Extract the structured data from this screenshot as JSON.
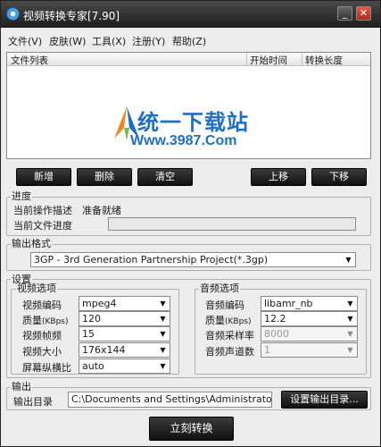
{
  "window": {
    "title": "视频转换专家[7.90]",
    "minimize_glyph": "_",
    "close_glyph": "✕"
  },
  "menu": [
    "文件(V)",
    "皮肤(W)",
    "工具(X)",
    "注册(Y)",
    "帮助(Z)"
  ],
  "file_list": {
    "columns": [
      "文件列表",
      "开始时间",
      "转换长度"
    ],
    "watermark_title": "统一下载站",
    "watermark_url": "Www.3987.Com"
  },
  "buttons": {
    "add": "新增",
    "delete": "删除",
    "clear": "清空",
    "up": "上移",
    "down": "下移"
  },
  "progress": {
    "group_title": "进度",
    "op_label": "当前操作描述",
    "op_value": "准备就绪",
    "file_label": "当前文件进度",
    "value_percent": 0
  },
  "output_format": {
    "group_title": "输出格式",
    "value": "3GP - 3rd Generation Partnership Project(*.3gp)"
  },
  "settings": {
    "group_title": "设置",
    "video": {
      "title": "视频选项",
      "codec_label": "视频编码",
      "codec_value": "mpeg4",
      "quality_label": "质量",
      "quality_unit": "(KBps)",
      "quality_value": "120",
      "fps_label": "视频帧频",
      "fps_value": "15",
      "size_label": "视频大小",
      "size_value": "176x144",
      "aspect_label": "屏幕纵横比",
      "aspect_value": "auto"
    },
    "audio": {
      "title": "音频选项",
      "codec_label": "音频编码",
      "codec_value": "libamr_nb",
      "quality_label": "质量",
      "quality_unit": "(KBps)",
      "quality_value": "12.2",
      "samplerate_label": "音频采样率",
      "samplerate_value": "8000",
      "channels_label": "音频声道数",
      "channels_value": "1"
    }
  },
  "output": {
    "group_title": "输出",
    "dir_label": "输出目录",
    "dir_value": "C:\\Documents and Settings\\Administrator\\桌面",
    "set_dir_button": "设置输出目录..."
  },
  "convert_button": "立刻转换"
}
